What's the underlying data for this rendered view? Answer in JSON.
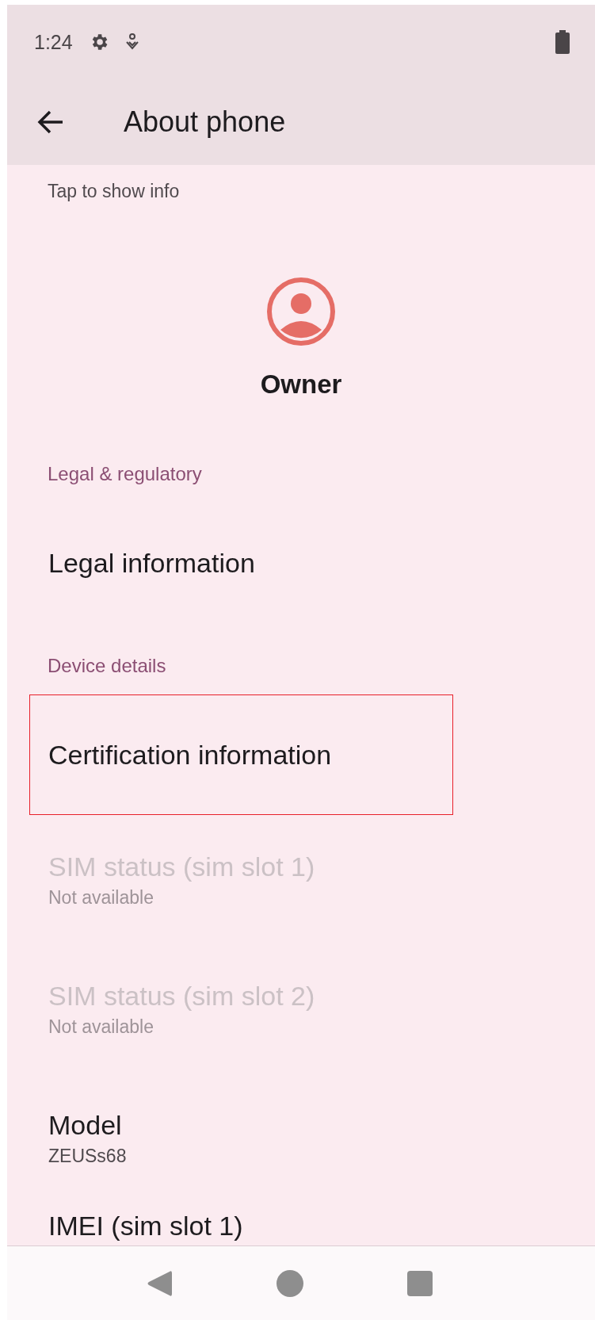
{
  "status_bar": {
    "time": "1:24"
  },
  "app_bar": {
    "title": "About phone"
  },
  "list": [
    {
      "kind": "partial",
      "summary": "Tap to show info",
      "disabled": false
    },
    {
      "kind": "profile",
      "name": "Owner"
    },
    {
      "kind": "header",
      "title": "Legal & regulatory"
    },
    {
      "kind": "item",
      "title": "Legal information",
      "disabled": false,
      "highlighted": false
    },
    {
      "kind": "header",
      "title": "Device details"
    },
    {
      "kind": "item",
      "title": "Certification information",
      "disabled": false,
      "highlighted": true
    },
    {
      "kind": "item",
      "title": "SIM status (sim slot 1)",
      "summary": "Not available",
      "disabled": true,
      "highlighted": false
    },
    {
      "kind": "item",
      "title": "SIM status (sim slot 2)",
      "summary": "Not available",
      "disabled": true,
      "highlighted": false
    },
    {
      "kind": "item",
      "title": "Model",
      "summary": "ZEUSs68",
      "disabled": false,
      "highlighted": false
    },
    {
      "kind": "item",
      "title": "IMEI (sim slot 1)",
      "disabled": false,
      "highlighted": false
    }
  ]
}
